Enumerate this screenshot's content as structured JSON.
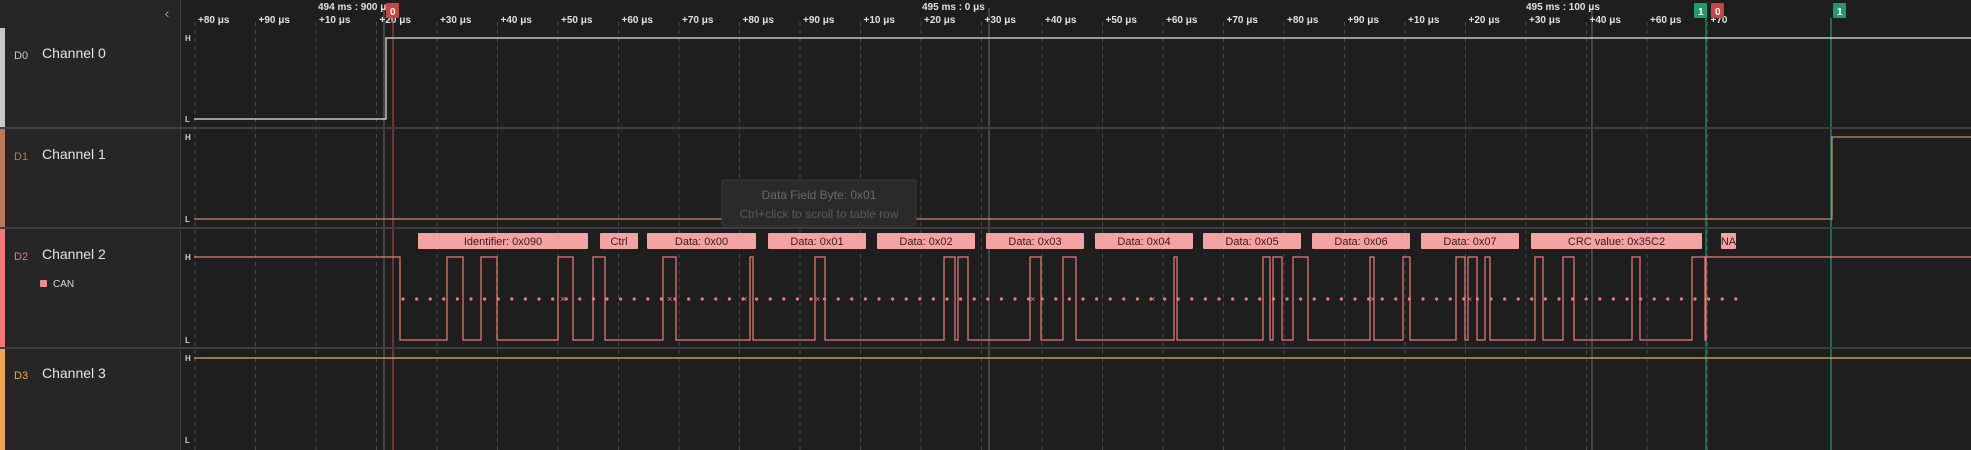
{
  "toolbar": {
    "collapse_icon": "chevron-left-icon",
    "collapse_glyph": "‹"
  },
  "timeline": {
    "major_labels": [
      "494 ms : 900 μs",
      "495 ms : 0 μs",
      "495 ms : 100 μs"
    ],
    "tick_labels": [
      "+80 μs",
      "+90 μs",
      "+10 μs",
      "+20 μs",
      "+30 μs",
      "+40 μs",
      "+50 μs",
      "+60 μs",
      "+70 μs",
      "+80 μs",
      "+90 μs",
      "+10 μs",
      "+20 μs",
      "+30 μs",
      "+40 μs",
      "+50 μs",
      "+60 μs",
      "+70 μs",
      "+80 μs",
      "+90 μs",
      "+10 μs",
      "+20 μs",
      "+30 μs",
      "+40 μs",
      "+60 μs",
      "+70"
    ],
    "markers": [
      {
        "label": "0",
        "color": "#c94545"
      },
      {
        "label": "1",
        "color": "#1f9c6b"
      },
      {
        "label": "0",
        "color": "#c94545"
      },
      {
        "label": "1",
        "color": "#1f9c6b"
      }
    ]
  },
  "channels": [
    {
      "id": "D0",
      "name": "Channel 0",
      "color": "#c8c8c8",
      "high": "H",
      "low": "L"
    },
    {
      "id": "D1",
      "name": "Channel 1",
      "color": "#b97a5a",
      "high": "H",
      "low": "L"
    },
    {
      "id": "D2",
      "name": "Channel 2",
      "color": "#f07a7a",
      "high": "H",
      "low": "L",
      "analyzer": "CAN"
    },
    {
      "id": "D3",
      "name": "Channel 3",
      "color": "#f0a850",
      "high": "H",
      "low": "L"
    }
  ],
  "can_frames": [
    "Identifier: 0x090",
    "Ctrl",
    "Data: 0x00",
    "Data: 0x01",
    "Data: 0x02",
    "Data: 0x03",
    "Data: 0x04",
    "Data: 0x05",
    "Data: 0x06",
    "Data: 0x07",
    "CRC value: 0x35C2",
    "NA"
  ],
  "tooltip": {
    "title": "Data Field Byte: 0x01",
    "hint": "Ctrl+click to scroll to table row"
  },
  "colors": {
    "background": "#1e1e1f",
    "can_label": "#f4a3a3",
    "grid": "#555555",
    "cursor_green": "#1f9c6b"
  }
}
